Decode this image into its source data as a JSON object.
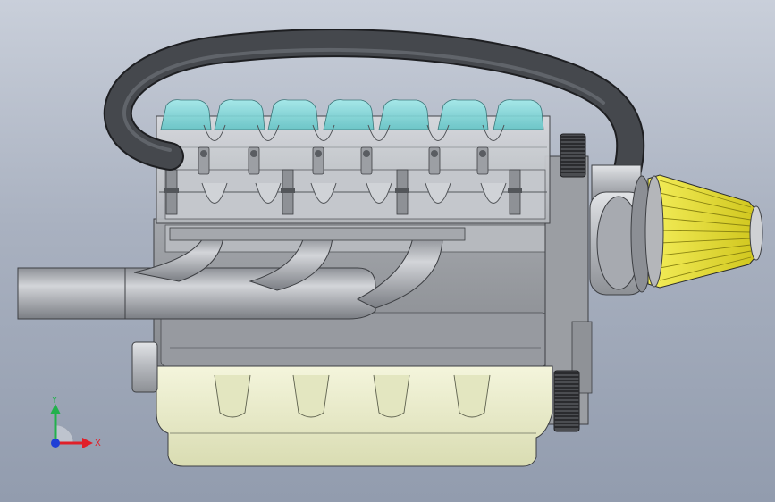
{
  "viewport": {
    "background_top": "#c9cfda",
    "background_bottom": "#929cae"
  },
  "model": {
    "colors": {
      "water_jacket": "#7fd6d6",
      "sump": "#eef0cc",
      "air_filter": "#e7e02c",
      "hose": "#3a3c40",
      "metal": "#b9bcc0",
      "block": "#8e9196"
    }
  },
  "triad": {
    "x_label": "X",
    "y_label": "Y",
    "x_color": "#e0202a",
    "y_color": "#22b14c",
    "z_color": "#1f3fd6"
  }
}
